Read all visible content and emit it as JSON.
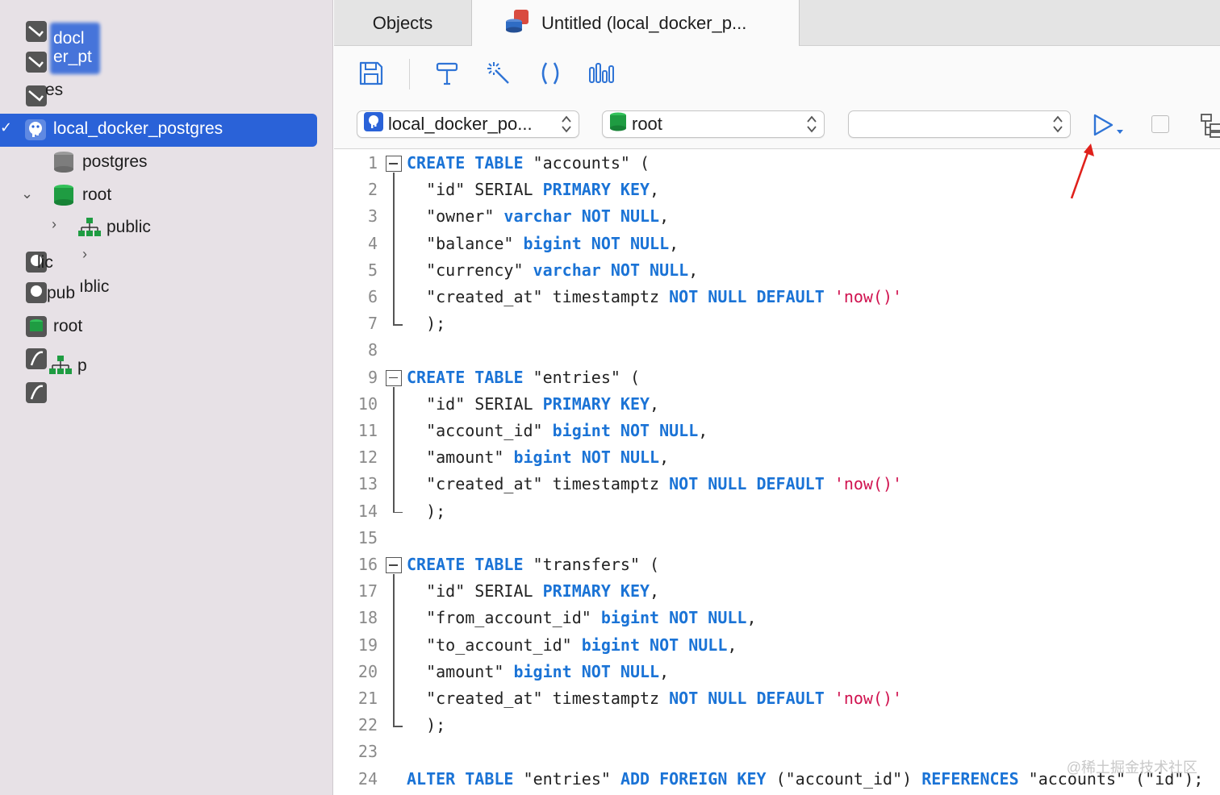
{
  "sidebar": {
    "ghost_items": [
      {
        "label": "docl"
      },
      {
        "label": "er_pt"
      },
      {
        "label": "es"
      },
      {
        "label": "lic"
      },
      {
        "label": "pub"
      },
      {
        "label": "ıblic"
      },
      {
        "label": "root"
      },
      {
        "label": "p"
      }
    ],
    "selected_connection": "local_docker_postgres",
    "databases": [
      {
        "label": "postgres"
      },
      {
        "label": "root"
      }
    ],
    "schema": "public"
  },
  "tabs": [
    {
      "label": "Objects"
    },
    {
      "label": "Untitled (local_docker_p..."
    }
  ],
  "toolbar": {
    "buttons": [
      "save-icon",
      "format-icon",
      "magic-wand-icon",
      "parentheses-icon",
      "chart-icon"
    ]
  },
  "selectors": {
    "connection": "local_docker_po...",
    "database": "root",
    "schema": ""
  },
  "editor": {
    "lines": [
      {
        "n": "1",
        "fold": "start",
        "segments": [
          [
            "kw",
            "CREATE"
          ],
          [
            "t",
            " "
          ],
          [
            "kw",
            "TABLE"
          ],
          [
            "t",
            " \"accounts\" ("
          ]
        ]
      },
      {
        "n": "2",
        "segments": [
          [
            "t",
            "  \"id\" SERIAL "
          ],
          [
            "kw",
            "PRIMARY KEY"
          ],
          [
            "t",
            ","
          ]
        ]
      },
      {
        "n": "3",
        "segments": [
          [
            "t",
            "  \"owner\" "
          ],
          [
            "kw",
            "varchar"
          ],
          [
            "t",
            " "
          ],
          [
            "kw",
            "NOT NULL"
          ],
          [
            "t",
            ","
          ]
        ]
      },
      {
        "n": "4",
        "segments": [
          [
            "t",
            "  \"balance\" "
          ],
          [
            "kw",
            "bigint"
          ],
          [
            "t",
            " "
          ],
          [
            "kw",
            "NOT NULL"
          ],
          [
            "t",
            ","
          ]
        ]
      },
      {
        "n": "5",
        "segments": [
          [
            "t",
            "  \"currency\" "
          ],
          [
            "kw",
            "varchar"
          ],
          [
            "t",
            " "
          ],
          [
            "kw",
            "NOT NULL"
          ],
          [
            "t",
            ","
          ]
        ]
      },
      {
        "n": "6",
        "segments": [
          [
            "t",
            "  \"created_at\" timestamptz "
          ],
          [
            "kw",
            "NOT NULL DEFAULT"
          ],
          [
            "t",
            " "
          ],
          [
            "str",
            "'now()'"
          ]
        ]
      },
      {
        "n": "7",
        "fold": "end",
        "segments": [
          [
            "t",
            "  );"
          ]
        ]
      },
      {
        "n": "8",
        "segments": []
      },
      {
        "n": "9",
        "fold": "start",
        "segments": [
          [
            "kw",
            "CREATE"
          ],
          [
            "t",
            " "
          ],
          [
            "kw",
            "TABLE"
          ],
          [
            "t",
            " \"entries\" ("
          ]
        ]
      },
      {
        "n": "10",
        "segments": [
          [
            "t",
            "  \"id\" SERIAL "
          ],
          [
            "kw",
            "PRIMARY KEY"
          ],
          [
            "t",
            ","
          ]
        ]
      },
      {
        "n": "11",
        "segments": [
          [
            "t",
            "  \"account_id\" "
          ],
          [
            "kw",
            "bigint"
          ],
          [
            "t",
            " "
          ],
          [
            "kw",
            "NOT NULL"
          ],
          [
            "t",
            ","
          ]
        ]
      },
      {
        "n": "12",
        "segments": [
          [
            "t",
            "  \"amount\" "
          ],
          [
            "kw",
            "bigint"
          ],
          [
            "t",
            " "
          ],
          [
            "kw",
            "NOT NULL"
          ],
          [
            "t",
            ","
          ]
        ]
      },
      {
        "n": "13",
        "segments": [
          [
            "t",
            "  \"created_at\" timestamptz "
          ],
          [
            "kw",
            "NOT NULL DEFAULT"
          ],
          [
            "t",
            " "
          ],
          [
            "str",
            "'now()'"
          ]
        ]
      },
      {
        "n": "14",
        "fold": "end",
        "segments": [
          [
            "t",
            "  );"
          ]
        ]
      },
      {
        "n": "15",
        "segments": []
      },
      {
        "n": "16",
        "fold": "start",
        "segments": [
          [
            "kw",
            "CREATE"
          ],
          [
            "t",
            " "
          ],
          [
            "kw",
            "TABLE"
          ],
          [
            "t",
            " \"transfers\" ("
          ]
        ]
      },
      {
        "n": "17",
        "segments": [
          [
            "t",
            "  \"id\" SERIAL "
          ],
          [
            "kw",
            "PRIMARY KEY"
          ],
          [
            "t",
            ","
          ]
        ]
      },
      {
        "n": "18",
        "segments": [
          [
            "t",
            "  \"from_account_id\" "
          ],
          [
            "kw",
            "bigint"
          ],
          [
            "t",
            " "
          ],
          [
            "kw",
            "NOT NULL"
          ],
          [
            "t",
            ","
          ]
        ]
      },
      {
        "n": "19",
        "segments": [
          [
            "t",
            "  \"to_account_id\" "
          ],
          [
            "kw",
            "bigint"
          ],
          [
            "t",
            " "
          ],
          [
            "kw",
            "NOT NULL"
          ],
          [
            "t",
            ","
          ]
        ]
      },
      {
        "n": "20",
        "segments": [
          [
            "t",
            "  \"amount\" "
          ],
          [
            "kw",
            "bigint"
          ],
          [
            "t",
            " "
          ],
          [
            "kw",
            "NOT NULL"
          ],
          [
            "t",
            ","
          ]
        ]
      },
      {
        "n": "21",
        "segments": [
          [
            "t",
            "  \"created_at\" timestamptz "
          ],
          [
            "kw",
            "NOT NULL DEFAULT"
          ],
          [
            "t",
            " "
          ],
          [
            "str",
            "'now()'"
          ]
        ]
      },
      {
        "n": "22",
        "fold": "end",
        "segments": [
          [
            "t",
            "  );"
          ]
        ]
      },
      {
        "n": "23",
        "segments": []
      },
      {
        "n": "24",
        "segments": [
          [
            "kw",
            "ALTER"
          ],
          [
            "t",
            " "
          ],
          [
            "kw",
            "TABLE"
          ],
          [
            "t",
            " \"entries\" "
          ],
          [
            "kw",
            "ADD FOREIGN KEY"
          ],
          [
            "t",
            " (\"account_id\") "
          ],
          [
            "kw",
            "REFERENCES"
          ],
          [
            "t",
            " \"accounts\" (\"id\");"
          ]
        ]
      }
    ]
  },
  "watermark": "@稀土掘金技术社区",
  "colors": {
    "keyword": "#1a73d6",
    "string": "#d0124f",
    "selection": "#2a62d8",
    "annotation_arrow": "#e0211b"
  }
}
